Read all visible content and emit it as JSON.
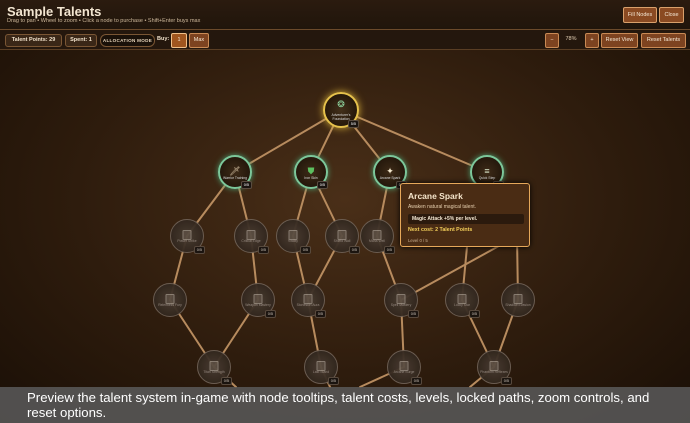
{
  "header": {
    "title": "Sample Talents",
    "subtitle": "Drag to pan • Wheel to zoom • Click a node to purchase • Shift+Enter buys max",
    "fill_nodes": "Fill Nodes",
    "close": "Close"
  },
  "toolbar": {
    "talent_points": "Talent Points: 29",
    "spent": "Spent: 1",
    "mode": "ALLOCATION MODE",
    "buy_label": "Buy:",
    "buy_value": "1",
    "max": "Max",
    "zoom_out": "−",
    "zoom_level": "78%",
    "zoom_in": "+",
    "reset_view": "Reset View",
    "reset_talents": "Reset Talents"
  },
  "nodes": {
    "root": {
      "label": "Adventurer's Foundation",
      "level": "5/5",
      "icon": "star-emblem-icon"
    },
    "warrior": {
      "label": "Warrior Training",
      "level": "0/5",
      "icon": "sword-icon"
    },
    "iron": {
      "label": "Iron Skin",
      "level": "0/5",
      "icon": "shield-icon"
    },
    "arcane": {
      "label": "Arcane Spark",
      "level": "0/5",
      "icon": "sparkle-icon"
    },
    "quick": {
      "label": "Quick Step",
      "level": "0/5",
      "icon": "speed-lines-icon"
    },
    "power_strike": {
      "label": "Power Strike",
      "level": "0/5"
    },
    "critical_edge": {
      "label": "Critical Edge",
      "level": "0/5"
    },
    "vitality": {
      "label": "Vitality",
      "level": "0/5"
    },
    "shield_wall": {
      "label": "Shield Wall",
      "level": "0/5"
    },
    "mana_well": {
      "label": "Mana Well",
      "level": "0/5"
    },
    "relentless": {
      "label": "Relentless Fury",
      "level": "0/5"
    },
    "weapon_mastery": {
      "label": "Weapon Mastery",
      "level": "0/5"
    },
    "fortitude": {
      "label": "Stoneskin Aura",
      "level": "0/5"
    },
    "spell_mastery": {
      "label": "Spell Mastery",
      "level": "0/5"
    },
    "lucky_star": {
      "label": "Lucky Star",
      "level": "0/5"
    },
    "evasion": {
      "label": "Shadow Evasion",
      "level": "0/5"
    },
    "titan": {
      "label": "Titan Strength",
      "level": "0/5"
    },
    "last_stand": {
      "label": "Last Stand",
      "level": "0/5"
    },
    "arcane_surge": {
      "label": "Arcane Surge",
      "level": "0/5"
    },
    "phantom": {
      "label": "Phantom Reflexes",
      "level": "0/5"
    }
  },
  "tooltip": {
    "title": "Arcane Spark",
    "description": "Awaken natural magical talent.",
    "effect": "Magic Attack +5% per level.",
    "cost": "Next cost: 2 Talent Points",
    "level": "Level 0 / 5"
  },
  "caption": "Preview the talent system in-game with node tooltips, talent costs, levels, locked paths, zoom controls, and reset options.",
  "colors": {
    "accent_button": "#8a4a22",
    "unlocked_ring": "#7cc79a",
    "root_ring": "#e6c24c",
    "cost_text": "#f3cf5a"
  }
}
